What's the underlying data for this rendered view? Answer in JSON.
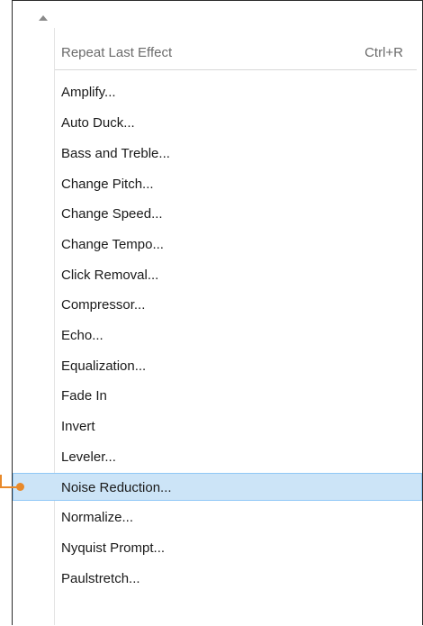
{
  "menu": {
    "repeat_last_effect": {
      "label": "Repeat Last Effect",
      "shortcut": "Ctrl+R"
    },
    "items": [
      {
        "label": "Amplify..."
      },
      {
        "label": "Auto Duck..."
      },
      {
        "label": "Bass and Treble..."
      },
      {
        "label": "Change Pitch..."
      },
      {
        "label": "Change Speed..."
      },
      {
        "label": "Change Tempo..."
      },
      {
        "label": "Click Removal..."
      },
      {
        "label": "Compressor..."
      },
      {
        "label": "Echo..."
      },
      {
        "label": "Equalization..."
      },
      {
        "label": "Fade In"
      },
      {
        "label": "Invert"
      },
      {
        "label": "Leveler..."
      },
      {
        "label": "Noise Reduction..."
      },
      {
        "label": "Normalize..."
      },
      {
        "label": "Nyquist Prompt..."
      },
      {
        "label": "Paulstretch..."
      }
    ],
    "highlighted_item": "Noise Reduction..."
  },
  "colors": {
    "highlight_bg": "#cce4f7",
    "highlight_border": "#90c8f6",
    "callout": "#e8892a"
  }
}
